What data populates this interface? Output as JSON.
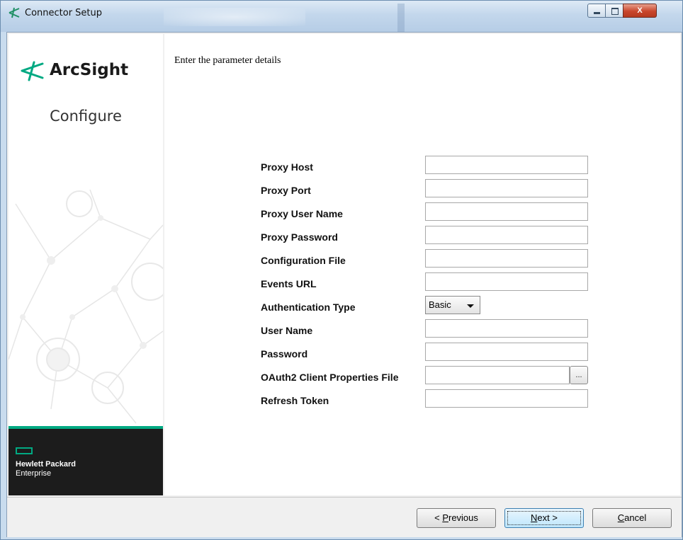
{
  "window": {
    "title": "Connector Setup",
    "controls": {
      "minimize": "",
      "maximize": "",
      "close": "X"
    }
  },
  "sidebar": {
    "logo_text": "ArcSight",
    "step_label": "Configure",
    "vendor_line1": "Hewlett Packard",
    "vendor_line2": "Enterprise",
    "accent_color": "#01a982"
  },
  "main": {
    "instructions": "Enter the parameter details",
    "fields": [
      {
        "label": "Proxy Host",
        "value": ""
      },
      {
        "label": "Proxy Port",
        "value": ""
      },
      {
        "label": "Proxy User Name",
        "value": ""
      },
      {
        "label": "Proxy Password",
        "value": ""
      },
      {
        "label": "Configuration File",
        "value": ""
      },
      {
        "label": "Events URL",
        "value": ""
      },
      {
        "label": "Authentication Type",
        "value": "Basic"
      },
      {
        "label": "User Name",
        "value": ""
      },
      {
        "label": "Password",
        "value": ""
      },
      {
        "label": "OAuth2 Client Properties File",
        "value": "",
        "browse_label": "..."
      },
      {
        "label": "Refresh Token",
        "value": ""
      }
    ]
  },
  "buttons": {
    "previous": {
      "prefix": "< ",
      "mnemonic": "P",
      "rest": "revious"
    },
    "next": {
      "mnemonic": "N",
      "rest": "ext >"
    },
    "cancel": {
      "mnemonic": "C",
      "rest": "ancel"
    }
  }
}
